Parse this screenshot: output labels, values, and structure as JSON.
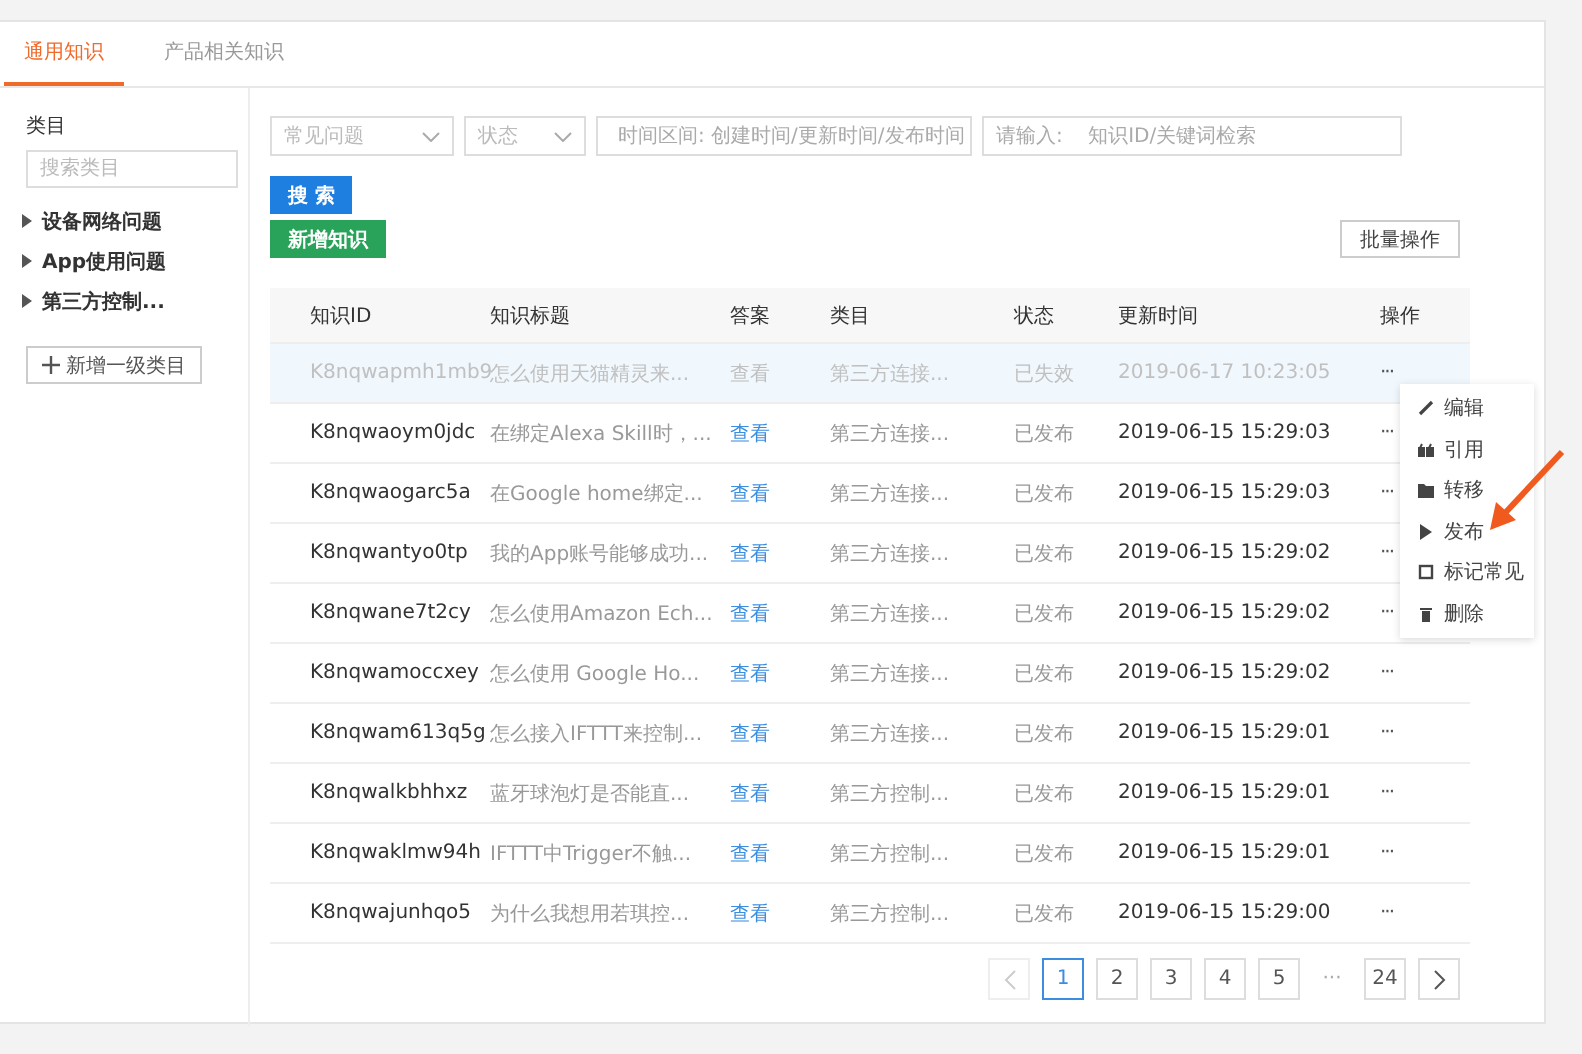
{
  "tabs": [
    {
      "label": "通用知识",
      "selected": true
    },
    {
      "label": "产品相关知识",
      "selected": false
    }
  ],
  "sidebar": {
    "title": "类目",
    "search": {
      "placeholder": "搜索类目"
    },
    "items": [
      {
        "label": "设备网络问题",
        "expanded": false
      },
      {
        "label": "App使用问题",
        "expanded": false
      },
      {
        "label": "第三方控制...",
        "expanded": false
      }
    ],
    "add_button": "新增一级类目"
  },
  "filters": {
    "type_select": {
      "placeholder": "常见问题"
    },
    "status_select": {
      "placeholder": "状态"
    },
    "date_range": {
      "placeholder": "时间区间: 创建时间/更新时间/发布时间"
    },
    "keyword": {
      "placeholder": "请输入:    知识ID/关键词检索"
    }
  },
  "search_button": "搜 索",
  "new_button": "新增知识",
  "batch_button": "批量操作",
  "table": {
    "columns": [
      "知识ID",
      "知识标题",
      "答案",
      "类目",
      "状态",
      "更新时间",
      "操作"
    ],
    "rows": [
      {
        "id": "K8nqwapmh1mb9",
        "title": "怎么使用天猫精灵来...",
        "answer": "查看",
        "category": "第三方连接...",
        "status": "已失效",
        "updated": "2019-06-17 10:23:05",
        "action": "···",
        "disabled": true,
        "highlighted": true
      },
      {
        "id": "K8nqwaoym0jdc",
        "title": "在绑定Alexa Skill时，...",
        "answer": "查看",
        "category": "第三方连接...",
        "status": "已发布",
        "updated": "2019-06-15 15:29:03",
        "action": "···",
        "disabled": false,
        "highlighted": false
      },
      {
        "id": "K8nqwaogarc5a",
        "title": "在Google home绑定...",
        "answer": "查看",
        "category": "第三方连接...",
        "status": "已发布",
        "updated": "2019-06-15 15:29:03",
        "action": "···",
        "disabled": false,
        "highlighted": false
      },
      {
        "id": "K8nqwantyo0tp",
        "title": "我的App账号能够成功...",
        "answer": "查看",
        "category": "第三方连接...",
        "status": "已发布",
        "updated": "2019-06-15 15:29:02",
        "action": "···",
        "disabled": false,
        "highlighted": false
      },
      {
        "id": "K8nqwane7t2cy",
        "title": "怎么使用Amazon Ech...",
        "answer": "查看",
        "category": "第三方连接...",
        "status": "已发布",
        "updated": "2019-06-15 15:29:02",
        "action": "···",
        "disabled": false,
        "highlighted": false
      },
      {
        "id": "K8nqwamoccxey",
        "title": "怎么使用 Google Ho...",
        "answer": "查看",
        "category": "第三方连接...",
        "status": "已发布",
        "updated": "2019-06-15 15:29:02",
        "action": "···",
        "disabled": false,
        "highlighted": false
      },
      {
        "id": "K8nqwam613q5g",
        "title": "怎么接入IFTTT来控制...",
        "answer": "查看",
        "category": "第三方连接...",
        "status": "已发布",
        "updated": "2019-06-15 15:29:01",
        "action": "···",
        "disabled": false,
        "highlighted": false
      },
      {
        "id": "K8nqwalkbhhxz",
        "title": "蓝牙球泡灯是否能直...",
        "answer": "查看",
        "category": "第三方控制...",
        "status": "已发布",
        "updated": "2019-06-15 15:29:01",
        "action": "···",
        "disabled": false,
        "highlighted": false
      },
      {
        "id": "K8nqwaklmw94h",
        "title": "IFTTT中Trigger不触...",
        "answer": "查看",
        "category": "第三方控制...",
        "status": "已发布",
        "updated": "2019-06-15 15:29:01",
        "action": "···",
        "disabled": false,
        "highlighted": false
      },
      {
        "id": "K8nqwajunhqo5",
        "title": "为什么我想用若琪控...",
        "answer": "查看",
        "category": "第三方控制...",
        "status": "已发布",
        "updated": "2019-06-15 15:29:00",
        "action": "···",
        "disabled": false,
        "highlighted": false
      }
    ]
  },
  "action_menu": [
    {
      "label": "编辑",
      "kind": "edit"
    },
    {
      "label": "引用",
      "kind": "quote"
    },
    {
      "label": "转移",
      "kind": "move"
    },
    {
      "label": "发布",
      "kind": "publish"
    },
    {
      "label": "标记常见",
      "kind": "mark"
    },
    {
      "label": "删除",
      "kind": "delete"
    }
  ],
  "pagination": {
    "prev_disabled": true,
    "next_disabled": false,
    "pages": [
      {
        "label": "1",
        "selected": true
      },
      {
        "label": "2",
        "selected": false
      },
      {
        "label": "3",
        "selected": false
      },
      {
        "label": "4",
        "selected": false
      },
      {
        "label": "5",
        "selected": false
      }
    ],
    "ellipsis": "···",
    "last": "24"
  }
}
